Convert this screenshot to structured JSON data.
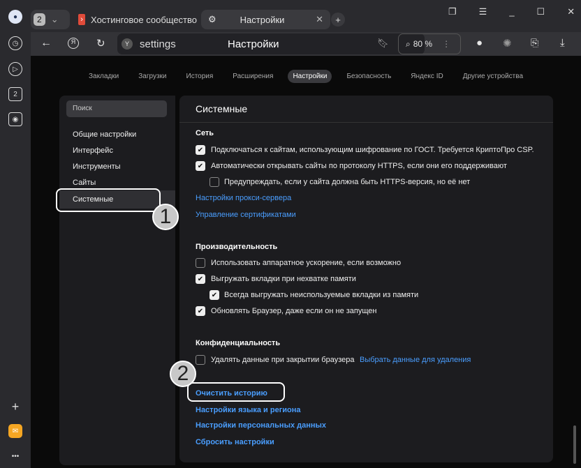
{
  "tabs": {
    "count": "2",
    "tab1": "Хостинговое сообщество",
    "tab2": "Настройки"
  },
  "toolbar": {
    "address": "settings",
    "page_title": "Настройки",
    "zoom": "80 %"
  },
  "sidebar_icons": {
    "tabs_badge": "2"
  },
  "nav": [
    "Закладки",
    "Загрузки",
    "История",
    "Расширения",
    "Настройки",
    "Безопасность",
    "Яндекс ID",
    "Другие устройства"
  ],
  "settings_menu": {
    "search_placeholder": "Поиск",
    "items": [
      "Общие настройки",
      "Интерфейс",
      "Инструменты",
      "Сайты",
      "Системные"
    ]
  },
  "main": {
    "title": "Системные",
    "network": {
      "heading": "Сеть",
      "options": [
        {
          "label": "Подключаться к сайтам, использующим шифрование по ГОСТ. Требуется КриптоПро CSP.",
          "checked": true
        },
        {
          "label": "Автоматически открывать сайты по протоколу HTTPS, если они его поддерживают",
          "checked": true
        },
        {
          "label": "Предупреждать, если у сайта должна быть HTTPS-версия, но её нет",
          "checked": false
        }
      ],
      "links": [
        "Настройки прокси-сервера",
        "Управление сертификатами"
      ]
    },
    "performance": {
      "heading": "Производительность",
      "options": [
        {
          "label": "Использовать аппаратное ускорение, если возможно",
          "checked": false
        },
        {
          "label": "Выгружать вкладки при нехватке памяти",
          "checked": true
        },
        {
          "label": "Всегда выгружать неиспользуемые вкладки из памяти",
          "checked": true
        },
        {
          "label": "Обновлять Браузер, даже если он не запущен",
          "checked": true
        }
      ]
    },
    "privacy": {
      "heading": "Конфиденциальность",
      "option": "Удалять данные при закрытии браузера",
      "option_link": "Выбрать данные для удаления"
    },
    "bottom_links": [
      "Очистить историю",
      "Настройки языка и региона",
      "Настройки персональных данных",
      "Сбросить настройки"
    ]
  },
  "callouts": [
    "1",
    "2"
  ]
}
